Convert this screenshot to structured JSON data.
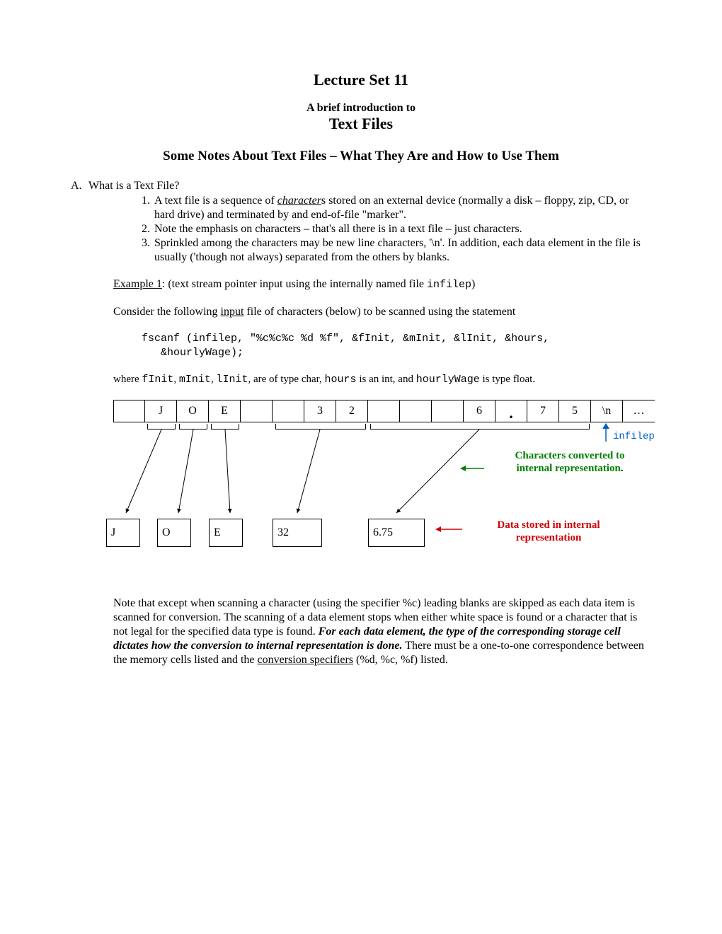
{
  "header": {
    "lecture": "Lecture Set 11",
    "intro": "A brief introduction to",
    "topic": "Text Files",
    "subtitle": "Some Notes About Text Files – What They Are and How to Use Them"
  },
  "sectionA": {
    "label": "A.",
    "heading": "What is a Text File?",
    "items": [
      {
        "pre": "A text file is a sequence of ",
        "u": "character",
        "post": "s stored on an external device (normally a disk – floppy, zip, CD, or hard drive) and terminated by and end-of-file \"marker\"."
      },
      "Note the emphasis on characters – that's all there is in a text file – just characters.",
      "Sprinkled among the characters may be new line characters, '\\n'.  In addition, each data element in the file is usually ('though not always) separated from the others by blanks."
    ]
  },
  "example": {
    "label": "Example 1",
    "desc_pre": ": (text stream pointer input using the internally named file ",
    "file": "infilep",
    "desc_post": ")",
    "consider_pre": "Consider the following ",
    "consider_ul": "input",
    "consider_post": " file of characters (below) to be scanned using the statement",
    "code1": "fscanf (infilep, \"%c%c%c %d %f\", &fInit, &mInit, &lInit, &hours,",
    "code2": "   &hourlyWage);",
    "where_pre": "where ",
    "v1": "fInit",
    "c1": ", ",
    "v2": "mInit",
    "c2": ", ",
    "v3": "lInit",
    "c3": ", are of type char, ",
    "v4": "hours",
    "c4": " is an int, and ",
    "v5": "hourlyWage",
    "c5": " is type float."
  },
  "stream": {
    "cells": [
      "",
      "J",
      "O",
      "E",
      "",
      "",
      "3",
      "2",
      "",
      "",
      "",
      "6",
      ".",
      "7",
      "5",
      "\\n",
      "…"
    ],
    "pointer_label": "infilep"
  },
  "labels": {
    "green1": "Characters converted to",
    "green2": "internal representation",
    "red1": "Data stored in internal",
    "red2": "representation"
  },
  "stored": {
    "b1": "J",
    "b2": "O",
    "b3": "E",
    "b4": "32",
    "b5": "6.75"
  },
  "footer": {
    "p1": "Note that except when scanning a character (using the specifier %c) leading blanks are skipped as each data item is scanned for conversion.  The scanning of a data element stops when either white space is found or a character that is not legal for the specified data type is found.  ",
    "p2": "For each data element, the type of the corresponding storage cell dictates how the conversion to internal representation is done.",
    "p3": "  There must be a one-to-one correspondence between the memory cells listed and the ",
    "p4": "conversion specifiers",
    "p5": " (%d, %c, %f) listed."
  }
}
